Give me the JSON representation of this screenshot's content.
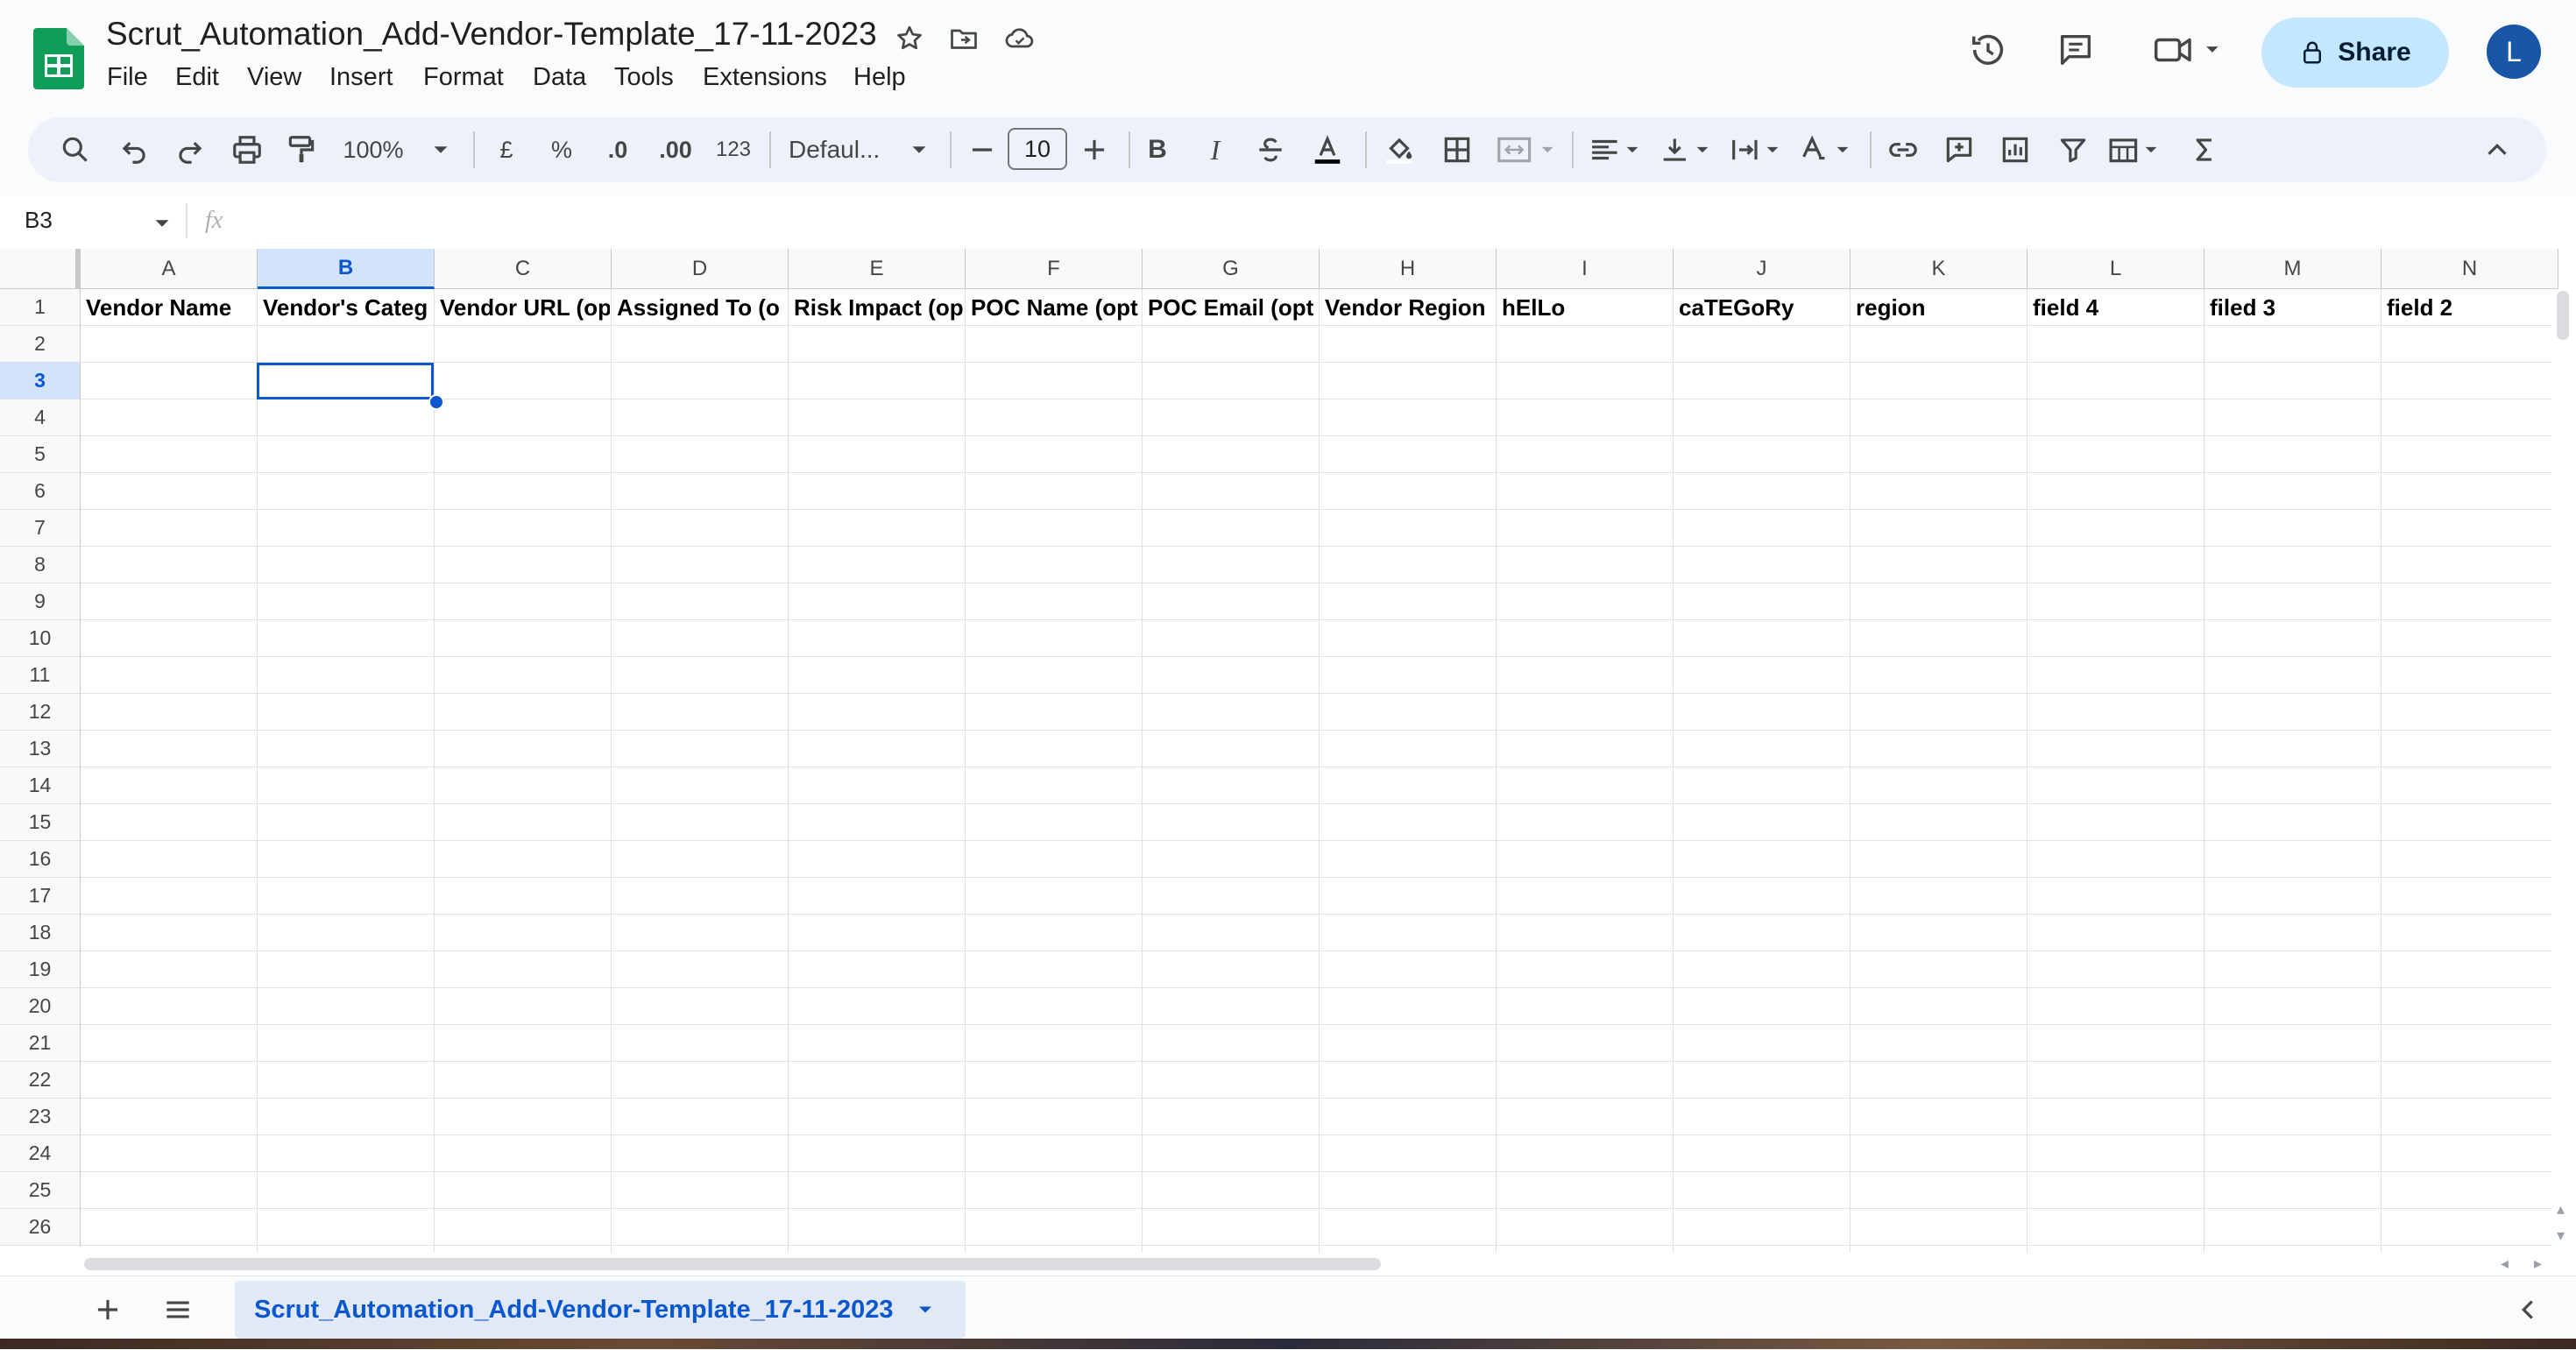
{
  "title_bar": {
    "doc_title": "Scrut_Automation_Add-Vendor-Template_17-11-2023",
    "menu": [
      "File",
      "Edit",
      "View",
      "Insert",
      "Format",
      "Data",
      "Tools",
      "Extensions",
      "Help"
    ],
    "share_label": "Share",
    "avatar_initial": "L"
  },
  "toolbar": {
    "zoom": "100%",
    "currency": "£",
    "percent": "%",
    "decrease_decimal": ".0",
    "increase_decimal": ".00",
    "number_format": "123",
    "font": "Defaul...",
    "font_size": "10",
    "bold": "B",
    "italic": "I"
  },
  "formula_bar": {
    "name_box": "B3",
    "fx": "fx"
  },
  "sheet": {
    "columns": [
      "A",
      "B",
      "C",
      "D",
      "E",
      "F",
      "G",
      "H",
      "I",
      "J",
      "K",
      "L",
      "M",
      "N"
    ],
    "selected_column": "B",
    "rows": [
      "1",
      "2",
      "3",
      "4",
      "5",
      "6",
      "7",
      "8",
      "9",
      "10",
      "11",
      "12",
      "13",
      "14",
      "15",
      "16",
      "17",
      "18",
      "19",
      "20",
      "21",
      "22",
      "23",
      "24",
      "25",
      "26"
    ],
    "selected_row": "3",
    "header_row": [
      "Vendor Name",
      "Vendor's Categ",
      "Vendor URL (op",
      "Assigned To (o",
      "Risk Impact (op",
      "POC Name (opt",
      "POC Email (opt",
      "Vendor Region",
      "hElLo",
      "caTEGoRy",
      "region",
      "field 4",
      "filed 3",
      "field 2"
    ]
  },
  "bottom_bar": {
    "sheet_tab": "Scrut_Automation_Add-Vendor-Template_17-11-2023"
  },
  "colors": {
    "accent": "#0b57d0",
    "share_bg": "#c2e7ff",
    "sheets_green": "#0f9d58",
    "selected_header": "#d3e3fd"
  }
}
